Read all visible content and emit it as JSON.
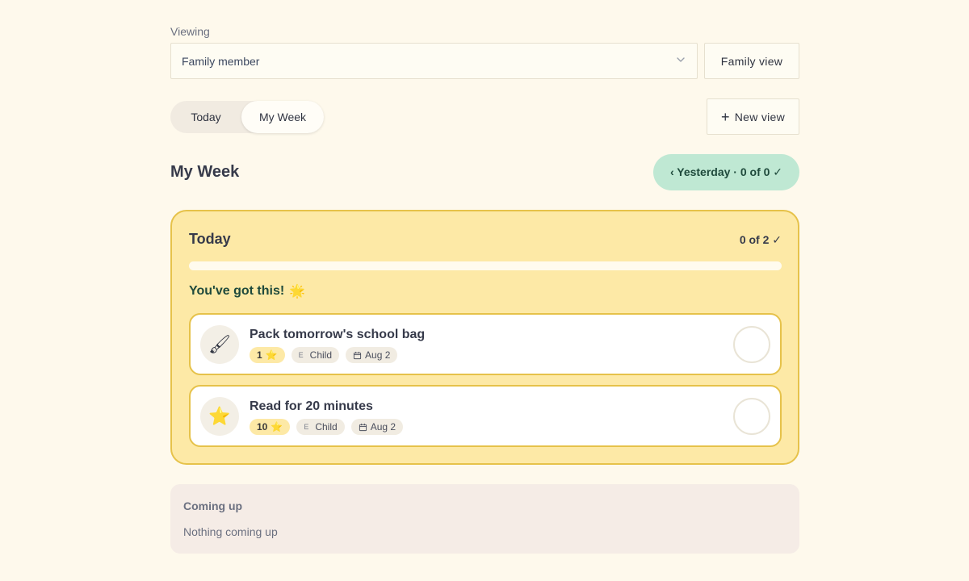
{
  "viewing": {
    "label": "Viewing",
    "selected": "Family member",
    "family_view_label": "Family view"
  },
  "tabs": [
    {
      "label": "Today"
    },
    {
      "label": "My Week",
      "active": true
    }
  ],
  "new_view_label": "New view",
  "page_title": "My Week",
  "yesterday_button": "‹ Yesterday · 0 of 0 ✓",
  "today_card": {
    "title": "Today",
    "count": "0 of 2 ✓",
    "progress_fraction": 0,
    "encouragement": "You've got this!",
    "tasks": [
      {
        "title": "Pack tomorrow's school bag",
        "icon": "paintbrush-icon",
        "points": "1",
        "assignee_initial": "E",
        "assignee": "Child",
        "date": "Aug 2"
      },
      {
        "title": "Read for 20 minutes",
        "icon": "star-icon",
        "points": "10",
        "assignee_initial": "E",
        "assignee": "Child",
        "date": "Aug 2"
      }
    ]
  },
  "coming_up": {
    "title": "Coming up",
    "empty_text": "Nothing coming up"
  },
  "colors": {
    "background": "#fef9ec",
    "today_card": "#fde9a6",
    "accent_border": "#e6c24a",
    "yesterday_pill": "#bfe8d3",
    "progress": "#5dbb8f"
  }
}
